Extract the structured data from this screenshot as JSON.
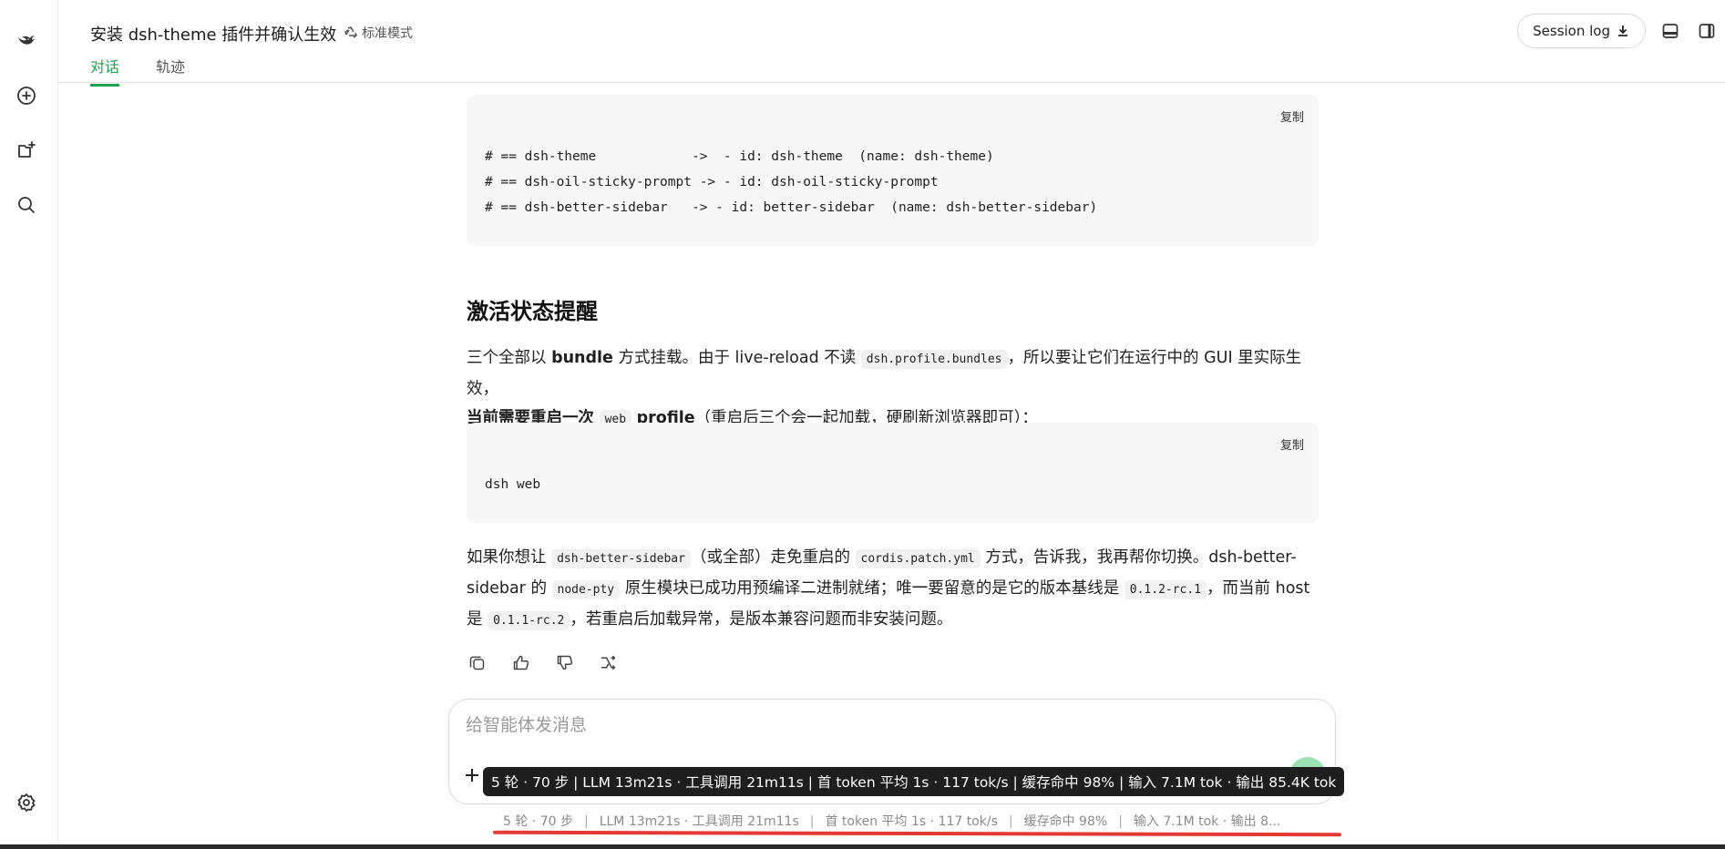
{
  "header": {
    "title": "安装 dsh-theme 插件并确认生效",
    "mode_label": "标准模式",
    "tabs": [
      {
        "label": "对话",
        "active": true
      },
      {
        "label": "轨迹",
        "active": false
      }
    ],
    "session_log_label": "Session log"
  },
  "content": {
    "code1": {
      "copy_label": "复制",
      "lines": [
        "# == dsh-theme            ->  - id: dsh-theme  (name: dsh-theme)",
        "# == dsh-oil-sticky-prompt -> - id: dsh-oil-sticky-prompt",
        "# == dsh-better-sidebar   -> - id: better-sidebar  (name: dsh-better-sidebar)"
      ]
    },
    "heading": "激活状态提醒",
    "para1": {
      "t1": "三个全部以 ",
      "b1": "bundle",
      "t2": " 方式挂载。由于 live-reload 不读 ",
      "c1": "dsh.profile.bundles",
      "t3": "，所以要让它们在运行中的 GUI 里实际生效，",
      "b2": "当前需要重启一次",
      "c2": "web",
      "b3": "profile",
      "t4": "（重启后三个会一起加载，硬刷新浏览器即可）："
    },
    "code2": {
      "copy_label": "复制",
      "lines": [
        "dsh web"
      ]
    },
    "para2": {
      "t1": "如果你想让 ",
      "c1": "dsh-better-sidebar",
      "t2": "（或全部）走免重启的 ",
      "c2": "cordis.patch.yml",
      "t3": " 方式，告诉我，我再帮你切换。dsh-better-sidebar 的 ",
      "c3": "node-pty",
      "t4": " 原生模块已成功用预编译二进制就绪；唯一要留意的是它的版本基线是 ",
      "c4": "0.1.2-rc.1",
      "t5": "，而当前 host 是 ",
      "c5": "0.1.1-rc.2",
      "t6": "，若重启后加载异常，是版本兼容问题而非安装问题。"
    }
  },
  "composer": {
    "placeholder": "给智能体发消息",
    "tooltip": "5 轮 · 70 步 | LLM 13m21s · 工具调用 21m11s | 首 token 平均 1s · 117 tok/s | 缓存命中 98% | 输入 7.1M tok · 输出 85.4K tok"
  },
  "stats": {
    "items": [
      "5 轮 · 70 步",
      "LLM 13m21s · 工具调用 21m11s",
      "首 token 平均 1s · 117 tok/s",
      "缓存命中 98%",
      "输入 7.1M tok · 输出 8..."
    ],
    "separator": "|"
  },
  "colors": {
    "accent": "#1aa34a",
    "send_button": "#9be3b3",
    "annotation_underline": "#e53935"
  }
}
